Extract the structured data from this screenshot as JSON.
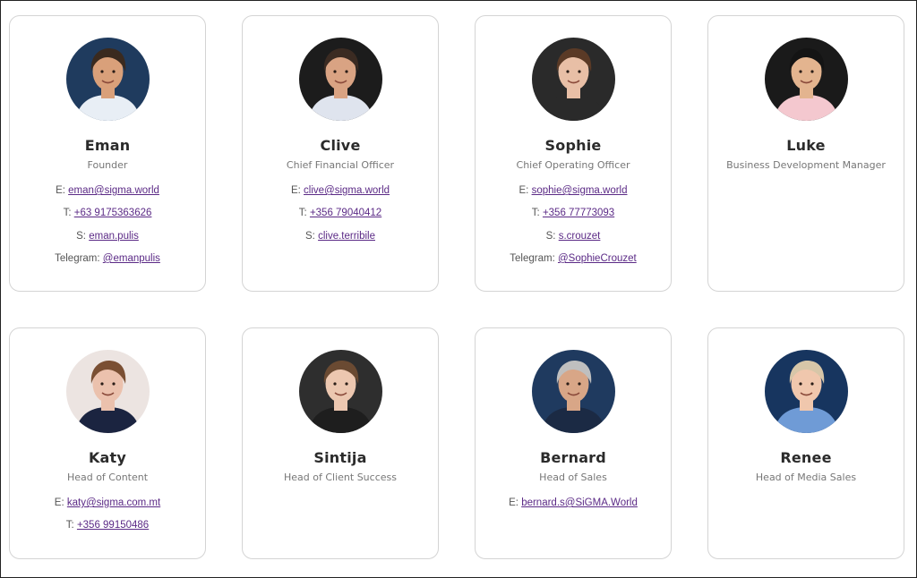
{
  "cards": [
    {
      "name": "Eman",
      "role": "Founder",
      "contacts": [
        {
          "label": "E:",
          "value": "eman@sigma.world"
        },
        {
          "label": "T:",
          "value": "+63 9175363626"
        },
        {
          "label": "S:",
          "value": "eman.pulis"
        },
        {
          "label": "Telegram:",
          "value": "@emanpulis"
        }
      ],
      "avatar": {
        "bg": "#1f3b5e",
        "skin": "#d9a07a",
        "hair": "#3a2a1f",
        "shirt": "#e8eef5"
      }
    },
    {
      "name": "Clive",
      "role": "Chief Financial Officer",
      "contacts": [
        {
          "label": "E:",
          "value": "clive@sigma.world"
        },
        {
          "label": "T:",
          "value": "+356 79040412"
        },
        {
          "label": "S:",
          "value": "clive.terribile"
        }
      ],
      "avatar": {
        "bg": "#1c1c1c",
        "skin": "#d9a383",
        "hair": "#3b2b22",
        "shirt": "#dfe4ee"
      }
    },
    {
      "name": "Sophie",
      "role": "Chief Operating Officer",
      "contacts": [
        {
          "label": "E:",
          "value": "sophie@sigma.world"
        },
        {
          "label": "T:",
          "value": "+356 77773093"
        },
        {
          "label": "S:",
          "value": "s.crouzet"
        },
        {
          "label": "Telegram:",
          "value": "@SophieCrouzet"
        }
      ],
      "avatar": {
        "bg": "#2a2a2a",
        "skin": "#e8bfa6",
        "hair": "#5a3a26",
        "shirt": "#2a2a2a"
      }
    },
    {
      "name": "Luke",
      "role": "Business Development Manager",
      "contacts": [],
      "avatar": {
        "bg": "#1a1a1a",
        "skin": "#e3b48f",
        "hair": "#141414",
        "shirt": "#f4c8cf"
      }
    },
    {
      "name": "Katy",
      "role": "Head of Content",
      "contacts": [
        {
          "label": "E:",
          "value": "katy@sigma.com.mt"
        },
        {
          "label": "T:",
          "value": "+356 99150486"
        }
      ],
      "avatar": {
        "bg": "#ece4e1",
        "skin": "#ebc1ad",
        "hair": "#7a4f33",
        "shirt": "#1b2440"
      }
    },
    {
      "name": "Sintija",
      "role": "Head of Client Success",
      "contacts": [],
      "avatar": {
        "bg": "#2e2e2e",
        "skin": "#ecc7b0",
        "hair": "#6a4a32",
        "shirt": "#1e1e1e"
      }
    },
    {
      "name": "Bernard",
      "role": "Head of Sales",
      "contacts": [
        {
          "label": "E:",
          "value": "bernard.s@SiGMA.World"
        }
      ],
      "avatar": {
        "bg": "#1f3a5f",
        "skin": "#d8a687",
        "hair": "#bfbfbf",
        "shirt": "#1b2a44"
      }
    },
    {
      "name": "Renee",
      "role": "Head of Media Sales",
      "contacts": [],
      "avatar": {
        "bg": "#17355f",
        "skin": "#f0c7ad",
        "hair": "#d7c6a8",
        "shirt": "#6f9bd6"
      }
    }
  ]
}
